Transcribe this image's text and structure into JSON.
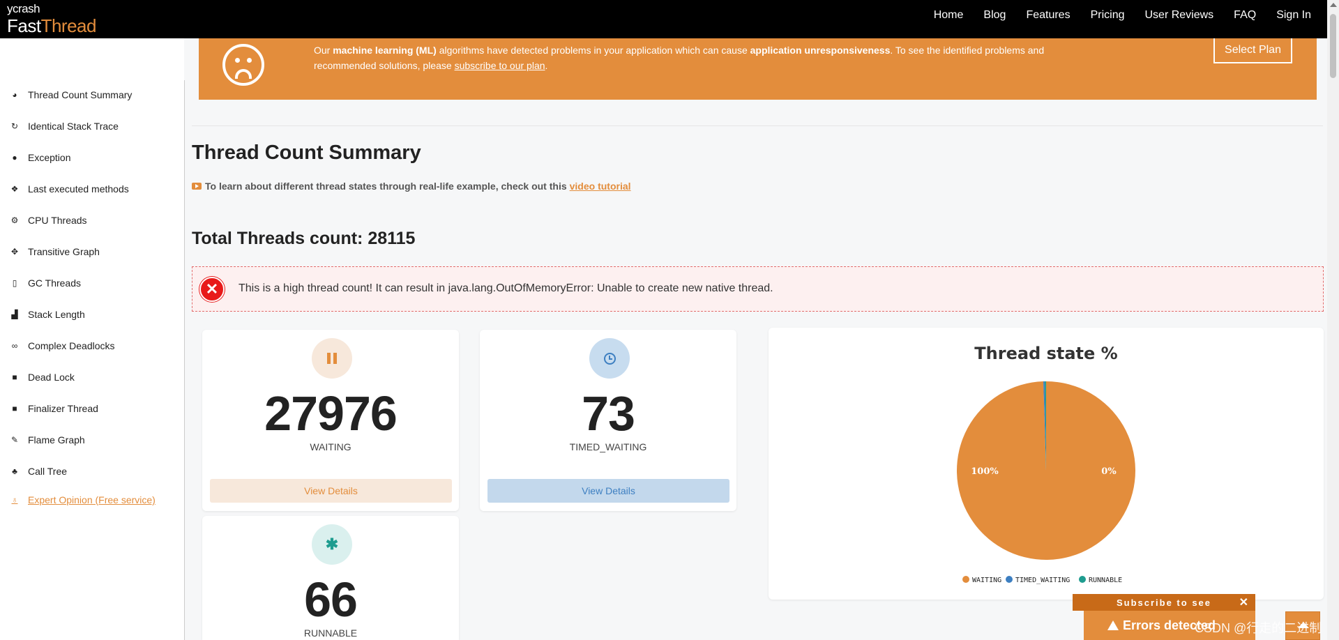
{
  "logo": {
    "ycrash": "ycrash",
    "fast": "Fast",
    "thread": "Thread"
  },
  "nav": [
    "Home",
    "Blog",
    "Features",
    "Pricing",
    "User Reviews",
    "FAQ",
    "Sign In"
  ],
  "sidebar": {
    "items": [
      {
        "label": "Thread Count Summary",
        "icon": "dashboard-icon"
      },
      {
        "label": "Identical Stack Trace",
        "icon": "refresh-icon"
      },
      {
        "label": "Exception",
        "icon": "exclamation-icon"
      },
      {
        "label": "Last executed methods",
        "icon": "cubes-icon"
      },
      {
        "label": "CPU Threads",
        "icon": "cogs-icon"
      },
      {
        "label": "Transitive Graph",
        "icon": "arrows-icon"
      },
      {
        "label": "GC Threads",
        "icon": "trash-icon"
      },
      {
        "label": "Stack Length",
        "icon": "signal-icon"
      },
      {
        "label": "Complex Deadlocks",
        "icon": "link-icon"
      },
      {
        "label": "Dead Lock",
        "icon": "lock-icon"
      },
      {
        "label": "Finalizer Thread",
        "icon": "stop-icon"
      },
      {
        "label": "Flame Graph",
        "icon": "fire-icon"
      },
      {
        "label": "Call Tree",
        "icon": "tree-icon"
      }
    ],
    "expert": "Expert Opinion (Free service)"
  },
  "banner": {
    "t1": "Our ",
    "b1": "machine learning (ML)",
    "t2": " algorithms have detected problems in your application which can cause ",
    "b2": "application unresponsiveness",
    "t3": ". To see the identified problems and recommended solutions, please ",
    "link": "subscribe to our plan",
    "t4": ".",
    "button": "Select Plan"
  },
  "page": {
    "title": "Thread Count Summary",
    "tutorial_text": "To learn about different thread states through real-life example, check out this",
    "tutorial_link": "video tutorial",
    "total": "Total Threads count: 28115",
    "alert": "This is a high thread count! It can result in java.lang.OutOfMemoryError: Unable to create new native thread."
  },
  "cards": [
    {
      "count": "27976",
      "label": "WAITING",
      "button": "View Details"
    },
    {
      "count": "73",
      "label": "TIMED_WAITING",
      "button": "View Details"
    },
    {
      "count": "66",
      "label": "RUNNABLE"
    }
  ],
  "chart_data": {
    "type": "pie",
    "title": "Thread state %",
    "categories": [
      "WAITING",
      "TIMED_WAITING",
      "RUNNABLE"
    ],
    "values": [
      27976,
      73,
      66
    ],
    "data_labels": [
      "100%",
      "0%"
    ],
    "colors": [
      "#e38d3c",
      "#3d7fc1",
      "#1e9c8f"
    ],
    "legend": "bottom"
  },
  "popup": {
    "subscribe": "Subscribe to see",
    "errors": "Errors detected",
    "watermark": "CSDN @行走的二进制"
  }
}
